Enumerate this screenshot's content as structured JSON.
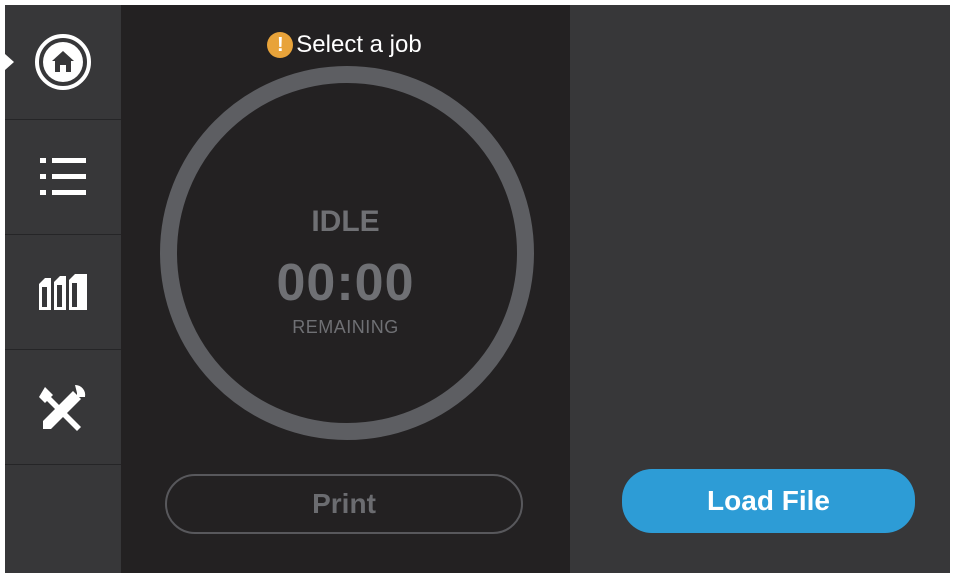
{
  "sidebar": {
    "items": [
      {
        "id": "home",
        "icon": "home-icon",
        "active": true
      },
      {
        "id": "queue",
        "icon": "list-icon",
        "active": false
      },
      {
        "id": "materials",
        "icon": "filament-spools-icon",
        "active": false
      },
      {
        "id": "utilities",
        "icon": "tools-icon",
        "active": false
      }
    ]
  },
  "job": {
    "message": "Select a job",
    "warning_icon": "!",
    "state": "IDLE",
    "time": "00:00",
    "time_label": "REMAINING",
    "progress_percent": 0
  },
  "actions": {
    "print_label": "Print",
    "load_file_label": "Load File"
  },
  "colors": {
    "accent": "#2d9cd6",
    "warning": "#e8a33a",
    "ring": "#5d5e62",
    "panel_dark": "#232122",
    "panel": "#373739"
  }
}
